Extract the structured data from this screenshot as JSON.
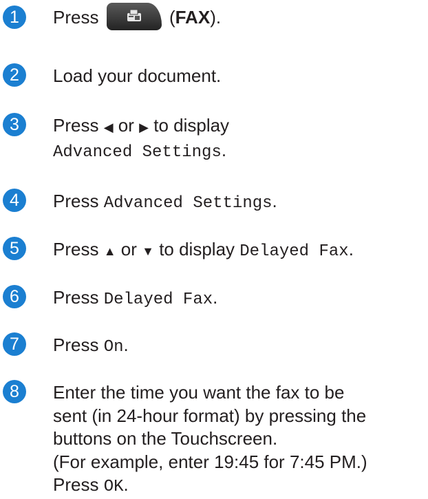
{
  "steps": [
    {
      "num": "1",
      "press": "Press",
      "fax_label": "FAX",
      "open": "(",
      "close": ")."
    },
    {
      "num": "2",
      "text": "Load your document."
    },
    {
      "num": "3",
      "a": "Press",
      "left": "◀",
      "or": "or",
      "right": "▶",
      "b": "to display",
      "code": "Advanced Settings",
      "end": "."
    },
    {
      "num": "4",
      "a": "Press",
      "code": "Advanced Settings",
      "end": "."
    },
    {
      "num": "5",
      "a": "Press",
      "up": "▲",
      "or": "or",
      "down": "▼",
      "b": "to display",
      "code": "Delayed Fax",
      "end": "."
    },
    {
      "num": "6",
      "a": "Press",
      "code": "Delayed Fax",
      "end": "."
    },
    {
      "num": "7",
      "a": "Press",
      "code": "On",
      "end": "."
    },
    {
      "num": "8",
      "line1": "Enter the time you want the fax to be",
      "line2": "sent (in 24-hour format) by pressing the",
      "line3": "buttons on the Touchscreen.",
      "line4": "(For example, enter 19:45 for 7:45 PM.)",
      "a": "Press",
      "code": "OK",
      "end": "."
    }
  ],
  "icons": {
    "fax_button": "fax-icon"
  },
  "colors": {
    "step_number": "#1b7fd1",
    "text": "#231f20"
  }
}
